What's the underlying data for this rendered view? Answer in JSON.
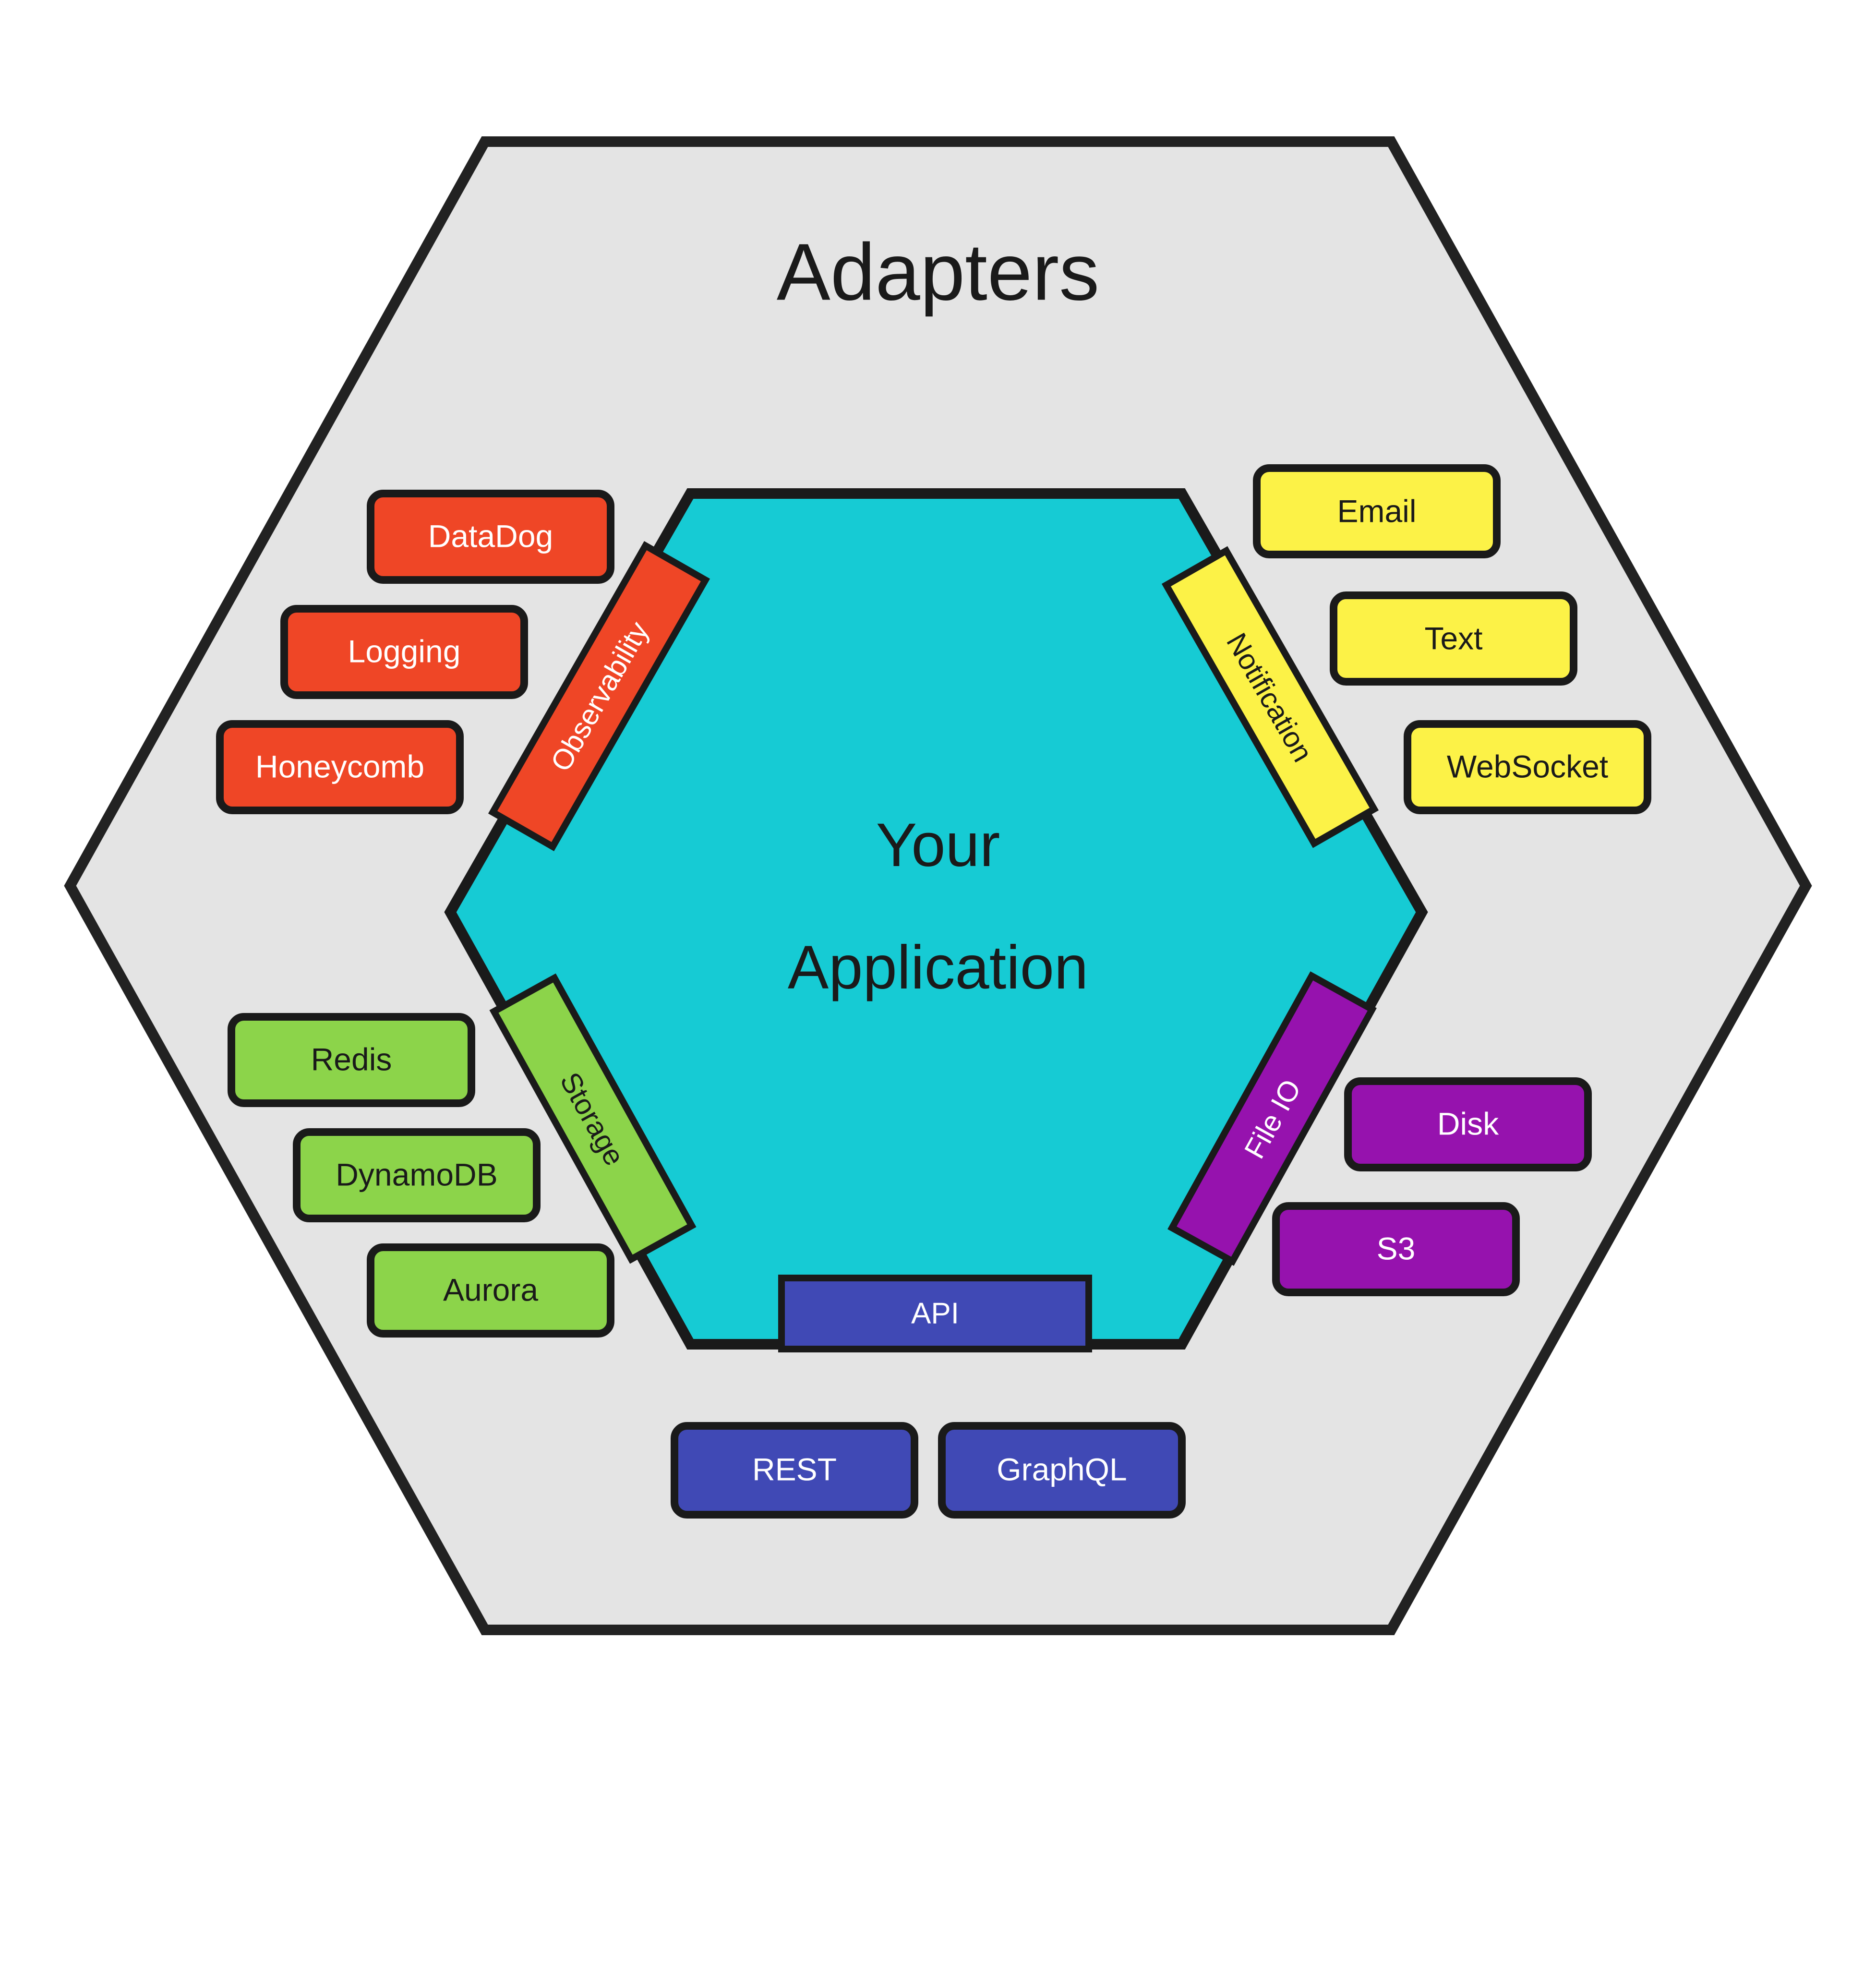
{
  "diagram": {
    "title": "Adapters",
    "core_label_line1": "Your",
    "core_label_line2": "Application",
    "colors": {
      "background": "#FFFFFF",
      "outer_ring": "#E4E4E4",
      "core": "#16CBD4",
      "stroke": "#1A1A1A",
      "observability": "#EF4626",
      "storage": "#8CD44A",
      "notification": "#FCF247",
      "file_io": "#9612AE",
      "api": "#4049B5"
    },
    "ports": [
      {
        "id": "observability",
        "label": "Observability",
        "color": "#EF4626",
        "text_color": "#FFFFFF"
      },
      {
        "id": "notification",
        "label": "Notification",
        "color": "#FCF247",
        "text_color": "#1A1A1A"
      },
      {
        "id": "storage",
        "label": "Storage",
        "color": "#8CD44A",
        "text_color": "#1A1A1A"
      },
      {
        "id": "file-io",
        "label": "File IO",
        "color": "#9612AE",
        "text_color": "#FFFFFF"
      },
      {
        "id": "api",
        "label": "API",
        "color": "#4049B5",
        "text_color": "#FFFFFF"
      }
    ],
    "adapters": [
      {
        "id": "datadog",
        "label": "DataDog",
        "port": "observability",
        "color": "#EF4626",
        "text_color": "#FFFFFF"
      },
      {
        "id": "logging",
        "label": "Logging",
        "port": "observability",
        "color": "#EF4626",
        "text_color": "#FFFFFF"
      },
      {
        "id": "honeycomb",
        "label": "Honeycomb",
        "port": "observability",
        "color": "#EF4626",
        "text_color": "#FFFFFF"
      },
      {
        "id": "redis",
        "label": "Redis",
        "port": "storage",
        "color": "#8CD44A",
        "text_color": "#1A1A1A"
      },
      {
        "id": "dynamodb",
        "label": "DynamoDB",
        "port": "storage",
        "color": "#8CD44A",
        "text_color": "#1A1A1A"
      },
      {
        "id": "aurora",
        "label": "Aurora",
        "port": "storage",
        "color": "#8CD44A",
        "text_color": "#1A1A1A"
      },
      {
        "id": "email",
        "label": "Email",
        "port": "notification",
        "color": "#FCF247",
        "text_color": "#1A1A1A"
      },
      {
        "id": "text",
        "label": "Text",
        "port": "notification",
        "color": "#FCF247",
        "text_color": "#1A1A1A"
      },
      {
        "id": "websocket",
        "label": "WebSocket",
        "port": "notification",
        "color": "#FCF247",
        "text_color": "#1A1A1A"
      },
      {
        "id": "disk",
        "label": "Disk",
        "port": "file-io",
        "color": "#9612AE",
        "text_color": "#FFFFFF"
      },
      {
        "id": "s3",
        "label": "S3",
        "port": "file-io",
        "color": "#9612AE",
        "text_color": "#FFFFFF"
      },
      {
        "id": "rest",
        "label": "REST",
        "port": "api",
        "color": "#4049B5",
        "text_color": "#FFFFFF"
      },
      {
        "id": "graphql",
        "label": "GraphQL",
        "port": "api",
        "color": "#4049B5",
        "text_color": "#FFFFFF"
      }
    ]
  }
}
